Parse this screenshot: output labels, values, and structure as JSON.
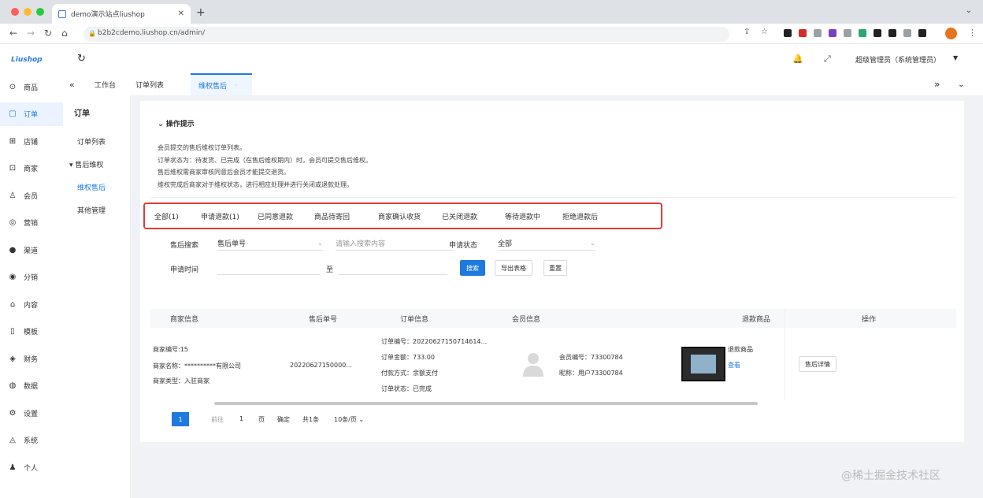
{
  "browser": {
    "tab_title": "demo演示站点liushop",
    "url": "b2b2cdemo.liushop.cn/admin/",
    "extension_colors": [
      "#222222",
      "#d62b2b",
      "#9aa0a6",
      "#7b3fc4",
      "#9aa0a6",
      "#2aa876",
      "#222222",
      "#222222",
      "#9aa0a6",
      "#222222"
    ]
  },
  "header": {
    "logo": "Liushop",
    "user": "超级管理员（系统管理员）"
  },
  "sidebar": {
    "items": [
      {
        "label": "商品",
        "icon": "bag"
      },
      {
        "label": "订单",
        "icon": "order"
      },
      {
        "label": "店铺",
        "icon": "shop"
      },
      {
        "label": "商家",
        "icon": "merchant"
      },
      {
        "label": "会员",
        "icon": "member"
      },
      {
        "label": "营销",
        "icon": "marketing"
      },
      {
        "label": "渠道",
        "icon": "channel"
      },
      {
        "label": "分销",
        "icon": "distribution"
      },
      {
        "label": "内容",
        "icon": "content"
      },
      {
        "label": "模板",
        "icon": "template"
      },
      {
        "label": "财务",
        "icon": "finance"
      },
      {
        "label": "数据",
        "icon": "data"
      },
      {
        "label": "设置",
        "icon": "settings"
      },
      {
        "label": "系统",
        "icon": "system"
      },
      {
        "label": "个人",
        "icon": "person"
      }
    ]
  },
  "page_tabs": {
    "items": [
      "工作台",
      "订单列表",
      "维权售后"
    ]
  },
  "subnav": {
    "title": "订单",
    "items": [
      "订单列表",
      "售后维权",
      "维权售后",
      "其他管理"
    ]
  },
  "tips": {
    "title": "操作提示",
    "lines": [
      "会员提交的售后维权订单列表。",
      "订单状态为：待发货、已完成（在售后维权期内）时，会员可提交售后维权。",
      "售后维权需商家审核同意后会员才能提交退货。",
      "维权完成后商家对于维权状态，进行相应处理并进行关闭或退款处理。"
    ]
  },
  "status_tabs": [
    "全部(1)",
    "申请退款(1)",
    "已同意退款",
    "商品待寄回",
    "商家确认收货",
    "已关闭退款",
    "等待退款中",
    "拒绝退款后"
  ],
  "filters": {
    "search_label": "售后搜索",
    "search_type": "售后单号",
    "search_placeholder": "请输入搜索内容",
    "status_label": "申请状态",
    "status_value": "全部",
    "date_label": "申请时间",
    "date_sep": "至",
    "btn_search": "搜索",
    "btn_export": "导出表格",
    "btn_reset": "重置"
  },
  "table": {
    "headers": [
      "商家信息",
      "售后单号",
      "订单信息",
      "会员信息",
      "退款商品",
      "操作"
    ],
    "row": {
      "shop_lines": [
        "商家编号:15",
        "商家名称：**********有限公司",
        "商家类型：入驻商家"
      ],
      "refund_no": "20220627150000...",
      "order_lines": [
        "订单编号：20220627150714614...",
        "订单金额：733.00",
        "付款方式：余额支付",
        "订单状态：已完成"
      ],
      "member_lines": [
        "会员编号：73300784",
        "昵称：用户73300784"
      ],
      "goods_lines": [
        "退款商品",
        "查看"
      ],
      "action": "售后详情"
    }
  },
  "pagination": {
    "current": "1",
    "prev": "前往",
    "page_num": "1",
    "page_unit": "页",
    "confirm": "确定",
    "total": "共1条",
    "page_size": "10条/页"
  },
  "watermark": "@稀土掘金技术社区"
}
